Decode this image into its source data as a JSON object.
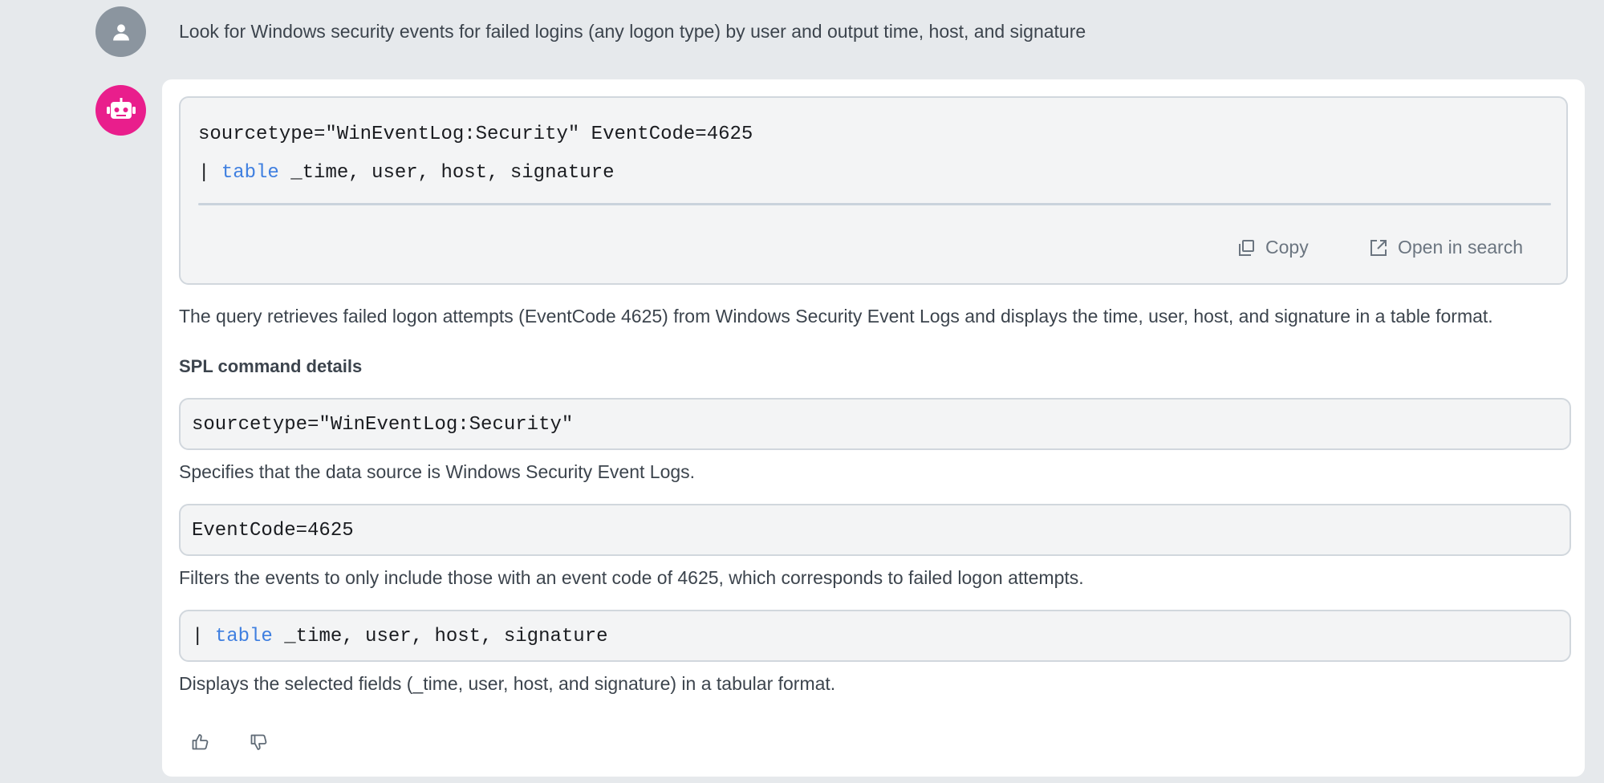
{
  "user_prompt": "Look for Windows security events for failed logins (any logon type) by user and output time, host, and signature",
  "avatars": {
    "user_icon": "user-icon",
    "bot_icon": "robot-icon",
    "user_color": "#8b959f",
    "bot_color": "#e91e8c"
  },
  "main_query": {
    "line1": "sourcetype=\"WinEventLog:Security\" EventCode=4625",
    "line2_pipe": "|",
    "line2_command": "table",
    "line2_args": " _time, user, host, signature"
  },
  "actions": {
    "copy_label": "Copy",
    "open_label": "Open in search"
  },
  "explanation": "The query retrieves failed logon attempts (EventCode 4625) from Windows Security Event Logs and displays the time, user, host, and signature in a table format.",
  "details": {
    "title": "SPL command details",
    "items": [
      {
        "code": "sourcetype=\"WinEventLog:Security\"",
        "description": "Specifies that the data source is Windows Security Event Logs."
      },
      {
        "code": "EventCode=4625",
        "description": "Filters the events to only include those with an event code of 4625, which corresponds to failed logon attempts."
      },
      {
        "code_pipe": "|",
        "code_command": "table",
        "code_args": " _time, user, host, signature",
        "description": "Displays the selected fields (_time, user, host, and signature) in a tabular format."
      }
    ]
  },
  "feedback": {
    "up_icon": "thumbs-up-icon",
    "down_icon": "thumbs-down-icon"
  },
  "colors": {
    "keyword": "#3f7fe0",
    "background": "#e6e9ec",
    "card": "#ffffff"
  }
}
